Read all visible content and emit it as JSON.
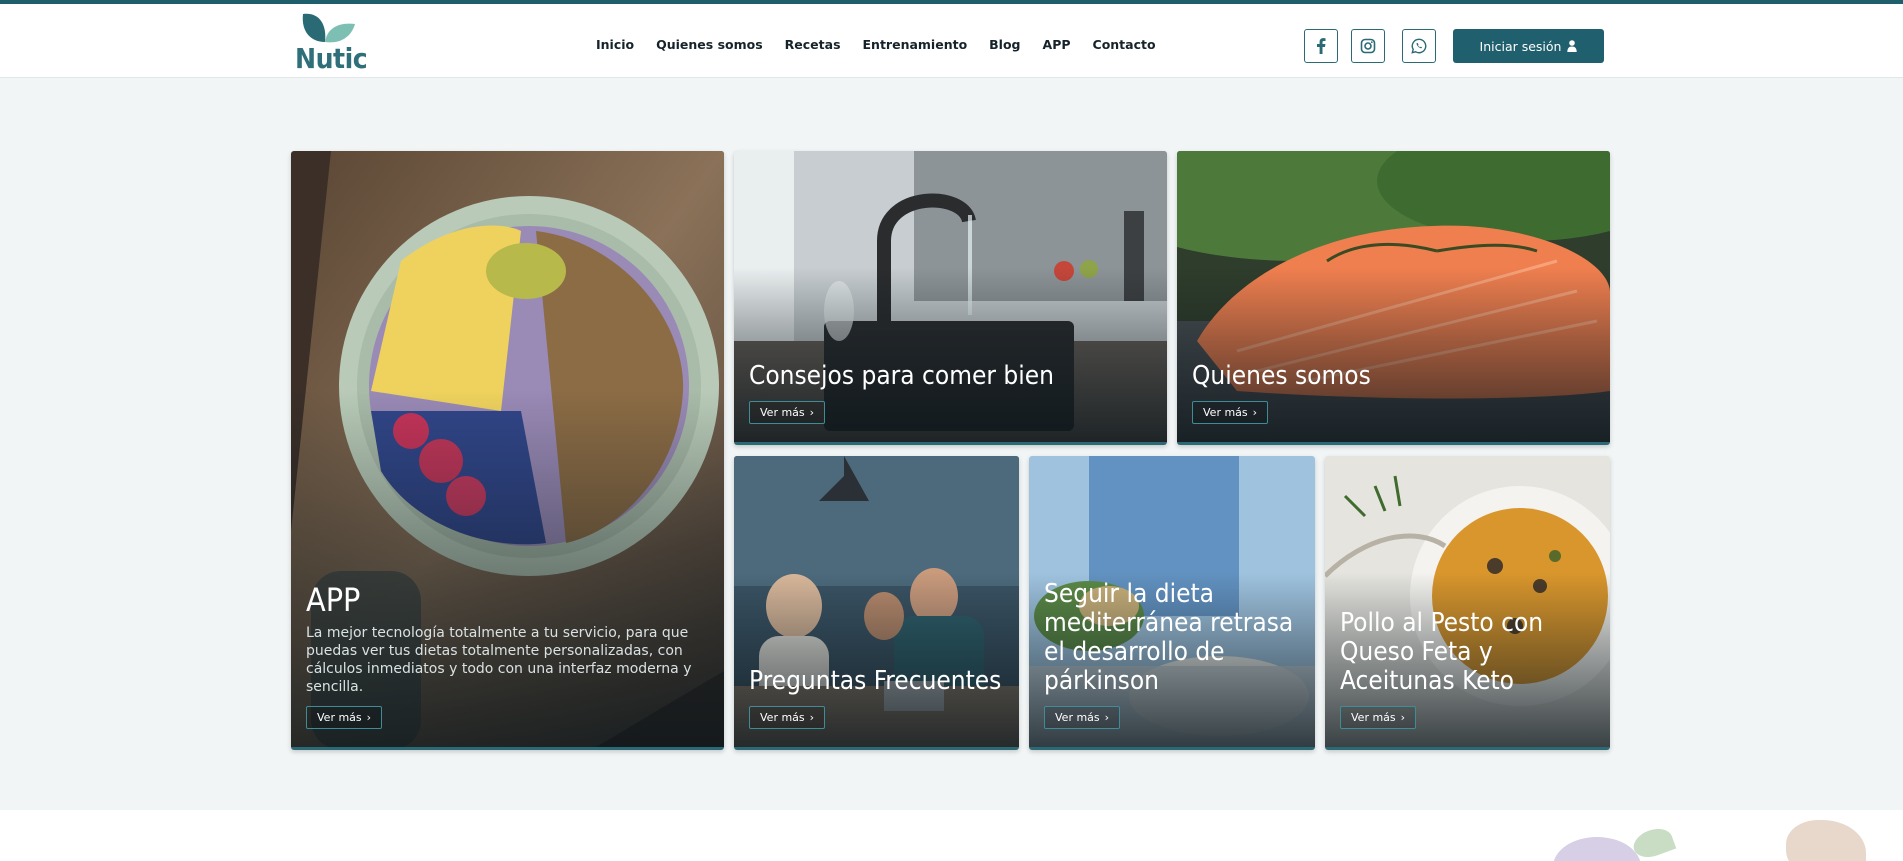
{
  "brand": {
    "name": "Nutic"
  },
  "nav": {
    "items": [
      "Inicio",
      "Quienes somos",
      "Recetas",
      "Entrenamiento",
      "Blog",
      "APP",
      "Contacto"
    ]
  },
  "header": {
    "social": [
      "facebook-icon",
      "instagram-icon",
      "whatsapp-icon"
    ],
    "login_label": "Iniciar sesión"
  },
  "cards": {
    "app": {
      "title": "APP",
      "description": "La mejor tecnología totalmente a tu servicio, para que puedas ver tus dietas totalmente personalizadas, con cálculos inmediatos y todo con una interfaz moderna y sencilla.",
      "button": "Ver más"
    },
    "consejos": {
      "title": "Consejos para comer bien",
      "button": "Ver más"
    },
    "quienes": {
      "title": "Quienes somos",
      "button": "Ver más"
    },
    "preguntas": {
      "title": "Preguntas Frecuentes",
      "button": "Ver más"
    },
    "dieta": {
      "title": "Seguir la dieta mediterránea retrasa el desarrollo de párkinson",
      "button": "Ver más"
    },
    "pollo": {
      "title": "Pollo al Pesto con Queso Feta y Aceitunas Keto",
      "button": "Ver más"
    }
  },
  "colors": {
    "accent": "#205f6d",
    "background": "#f1f5f5",
    "nav_text": "#16232a"
  }
}
